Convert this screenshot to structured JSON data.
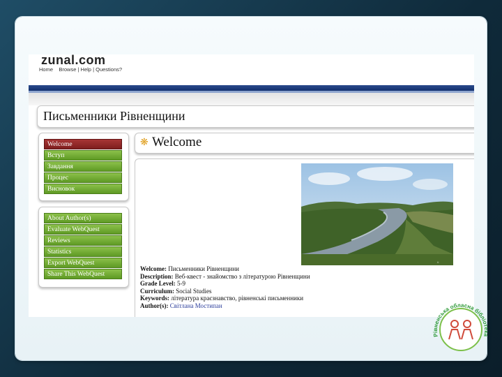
{
  "site": {
    "logo": "zunal.com",
    "nav_home": "Home",
    "nav_browse": "Browse",
    "nav_help": "Help",
    "nav_questions": "Questions?"
  },
  "page_title": "Письменники Рівненщини",
  "nav_group_1": [
    {
      "label": "Welcome",
      "active": true
    },
    {
      "label": "Вступ",
      "active": false
    },
    {
      "label": "Завдання",
      "active": false
    },
    {
      "label": "Процес",
      "active": false
    },
    {
      "label": "Висновок",
      "active": false
    }
  ],
  "nav_group_2": [
    {
      "label": "About Author(s)"
    },
    {
      "label": "Evaluate WebQuest"
    },
    {
      "label": "Reviews"
    },
    {
      "label": "Statistics"
    },
    {
      "label": "Export WebQuest"
    },
    {
      "label": "Share This WebQuest"
    }
  ],
  "welcome_heading": "Welcome",
  "info": {
    "welcome_label": "Welcome:",
    "welcome_value": "Письменники Рівненщини",
    "description_label": "Description:",
    "description_value": "Веб-квест - знайомство з літературою Рівненщини",
    "grade_label": "Grade Level:",
    "grade_value": "5-9",
    "curriculum_label": "Curriculum:",
    "curriculum_value": "Social Studies",
    "keywords_label": "Keywords:",
    "keywords_value": "література краєзнавство, рівненські письменники",
    "author_label": "Author(s):",
    "author_value": "Світлана Мостипан"
  },
  "badge": {
    "text": "Рівненська обласна бібліотека для дітей"
  },
  "colors": {
    "nav_green": "#6fa830",
    "nav_active": "#962a2a",
    "blue_bar": "#1d3a7c",
    "author_link": "#2a3c9a"
  }
}
